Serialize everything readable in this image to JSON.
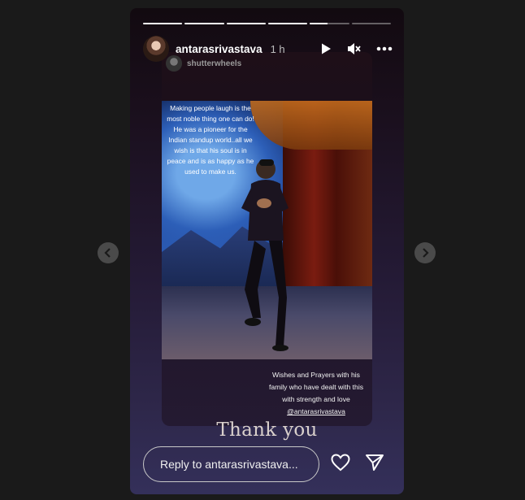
{
  "progress": [
    1,
    1,
    1,
    1,
    0.45,
    0
  ],
  "user": {
    "name": "antarasrivastava",
    "time": "1 h"
  },
  "repost": {
    "name": "shutterwheels"
  },
  "card": {
    "caption_top": "Making people laugh is the most noble thing one can do! He was a pioneer for the Indian standup world..all we wish is that his soul is in peace and is as happy as he used to make us.",
    "caption_bottom_lines": [
      "Wishes and Prayers with his",
      "family who have dealt with this",
      "with strength and love"
    ],
    "mention": "@antarasrivastava"
  },
  "thank_you": "Thank you",
  "reply": {
    "placeholder": "Reply to antarasrivastava..."
  },
  "icons": {
    "play": "play-icon",
    "mute": "mute-icon",
    "more": "more-icon",
    "heart": "heart-icon",
    "send": "send-icon",
    "prev": "chevron-left-icon",
    "next": "chevron-right-icon"
  }
}
